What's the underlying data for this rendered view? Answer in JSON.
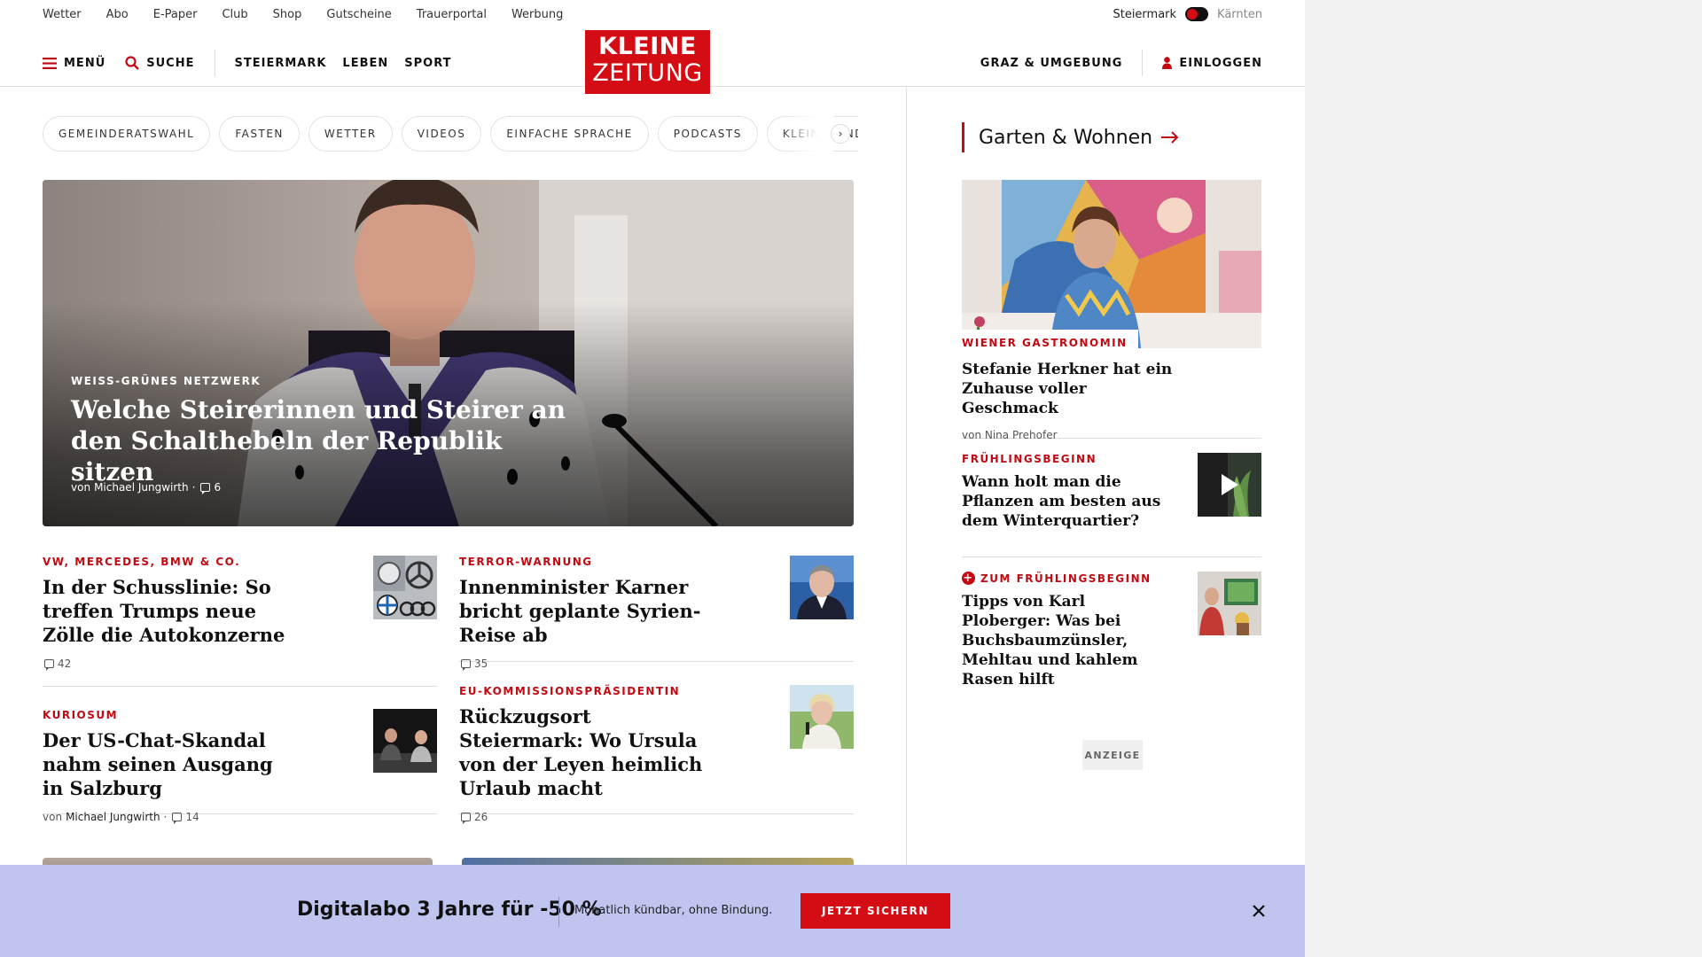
{
  "utility_nav": {
    "links": [
      "Wetter",
      "Abo",
      "E-Paper",
      "Club",
      "Shop",
      "Gutscheine",
      "Trauerportal",
      "Werbung"
    ],
    "region_active": "Steiermark",
    "region_inactive": "Kärnten"
  },
  "header": {
    "menu_label": "MENÜ",
    "search_label": "SUCHE",
    "nav": [
      "STEIERMARK",
      "LEBEN",
      "SPORT"
    ],
    "logo_line1": "KLEINE",
    "logo_line2": "ZEITUNG",
    "region_label": "GRAZ & UMGEBUNG",
    "login_label": "EINLOGGEN"
  },
  "topic_chips": [
    "GEMEINDERATSWAHL",
    "FASTEN",
    "WETTER",
    "VIDEOS",
    "EINFACHE SPRACHE",
    "PODCASTS",
    "KLEINE KINDER"
  ],
  "hero": {
    "kicker": "WEISS-GRÜNES NETZWERK",
    "title": "Welche Steirerinnen und Steirer an den Schalthebeln der Republik sitzen",
    "author_prefix": "von",
    "author": "Michael Jungwirth",
    "separator": "·",
    "comments": "6"
  },
  "articles": [
    {
      "kicker": "VW, MERCEDES, BMW & CO.",
      "title": "In der Schusslinie: So treffen Trumps neue Zölle die Autokonzerne",
      "comments": "42"
    },
    {
      "kicker": "TERROR-WARNUNG",
      "title": "Innenminister Karner bricht geplante Syrien-Reise ab",
      "comments": "35"
    },
    {
      "kicker": "KURIOSUM",
      "title": "Der US-Chat-Skandal nahm seinen Ausgang in Salzburg",
      "author_prefix": "von",
      "author": "Michael Jungwirth",
      "separator": "·",
      "comments": "14"
    },
    {
      "kicker": "EU-KOMMISSIONSPRÄSIDENTIN",
      "title": "Rückzugsort Steiermark: Wo Ursula von der Leyen heimlich Urlaub macht",
      "comments": "26"
    }
  ],
  "sidebar": {
    "section_title": "Garten & Wohnen",
    "feature": {
      "kicker": "WIENER GASTRONOMIN",
      "title": "Stefanie Herkner hat ein Zuhause voller Geschmack",
      "author": "von Nina Prehofer"
    },
    "items": [
      {
        "kicker": "FRÜHLINGSBEGINN",
        "title": "Wann holt man die Pflanzen am besten aus dem Winterquartier?"
      },
      {
        "kicker": "ZUM FRÜHLINGSBEGINN",
        "title": "Tipps von Karl Ploberger: Was bei Buchsbaumzünsler, Mehltau und kahlem Rasen hilft"
      }
    ],
    "ad_label": "ANZEIGE"
  },
  "promo": {
    "headline": "Digitalabo 3 Jahre für -50 %",
    "subline": "Monatlich kündbar, ohne Bindung.",
    "cta": "JETZT SICHERN"
  },
  "colors": {
    "brand_red": "#d40d14",
    "kicker_red": "#c10a12",
    "promo_bg": "#bfc5ef"
  },
  "icons": [
    "hamburger-icon",
    "search-icon",
    "user-icon",
    "chevron-right-icon",
    "arrow-right-icon",
    "comment-icon",
    "plus-icon",
    "play-icon",
    "close-icon"
  ]
}
